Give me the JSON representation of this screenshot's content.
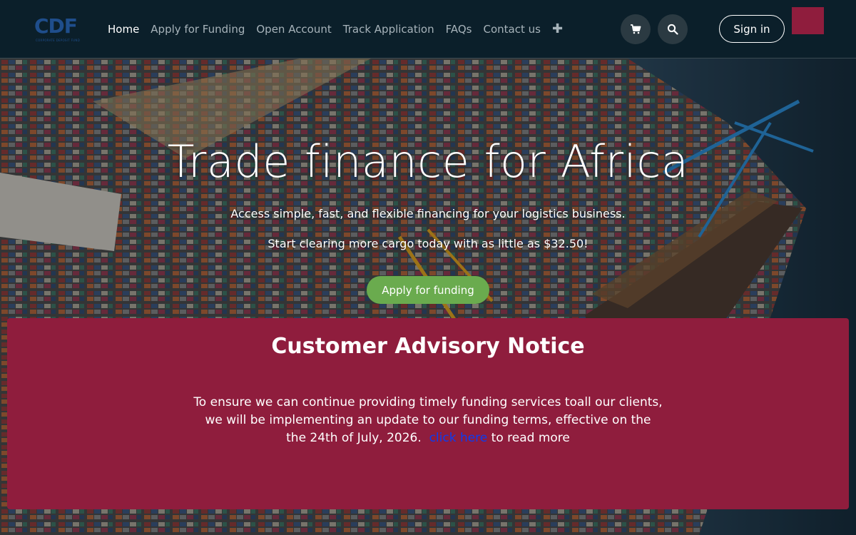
{
  "header": {
    "logo": {
      "letters": "CDF",
      "tagline": "CORPORATE DEPOSIT FUND"
    },
    "nav": [
      {
        "label": "Home",
        "active": true
      },
      {
        "label": "Apply for Funding"
      },
      {
        "label": "Open Account"
      },
      {
        "label": "Track Application"
      },
      {
        "label": "FAQs"
      },
      {
        "label": "Contact us"
      }
    ],
    "more_icon": "plus-icon",
    "cart_icon": "shopping-cart-icon",
    "search_icon": "search-icon",
    "signin_label": "Sign in"
  },
  "hero": {
    "title": "Trade finance for Africa",
    "subtitle_1": "Access simple, fast, and flexible financing for your logistics business.",
    "subtitle_2": "Start clearing more cargo today with as little as $32.50!",
    "cta_label": "Apply for funding"
  },
  "notice": {
    "title": "Customer Advisory Notice",
    "line_1": "To ensure we can continue providing timely funding services toall our clients,",
    "line_2": "we will be implementing an update to our funding terms, effective on the",
    "line_3_pre": "the 24th of July, 2026.",
    "link_label": "click here",
    "line_3_post": "to read more"
  },
  "colors": {
    "header_bg": "#0b1f2a",
    "accent_crimson": "#8f1d3d",
    "cta_green": "#6aab4e",
    "link_blue": "#0b3cf0"
  }
}
